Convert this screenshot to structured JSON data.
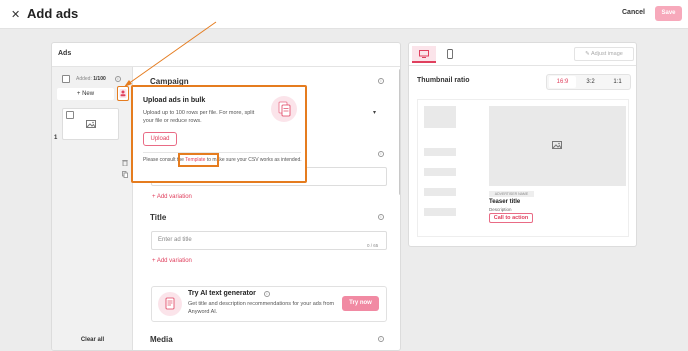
{
  "header": {
    "close_icon": "close-icon",
    "title": "Add ads",
    "cancel_label": "Cancel",
    "save_label": "Save"
  },
  "ads": {
    "heading": "Ads",
    "added_label": "Added:",
    "added_count": "1/100",
    "new_button": "+ New",
    "row_number": "1",
    "clear_all": "Clear all"
  },
  "form": {
    "campaign_label": "Campaign",
    "add_variation_label": "+ Add variation",
    "title_label": "Title",
    "title_placeholder": "Enter ad title",
    "title_counter": "0 / 65",
    "media_label": "Media"
  },
  "ai_generator": {
    "title": "Try AI text generator",
    "description": "Get title and description recommendations for your ads from Anyword AI.",
    "button": "Try now"
  },
  "bulk_upload_popup": {
    "title": "Upload ads in bulk",
    "description": "Upload up to 100 rows per file. For more, split your file or reduce rows.",
    "upload_button": "Upload",
    "note_prefix": "Please consult the",
    "template_link": "Template",
    "note_suffix": "to make sure your CSV works as intended."
  },
  "preview": {
    "adjust_image": "Adjust image",
    "thumbnail_ratio_label": "Thumbnail ratio",
    "ratios": [
      "16:9",
      "3:2",
      "1:1"
    ],
    "selected_ratio": "16:9",
    "advertiser_name": "ADVERTISER NAME",
    "teaser_title": "Teaser title",
    "description": "Description",
    "cta": "Call to action"
  },
  "colors": {
    "accent": "#e0405e",
    "annotation": "#e57c1f",
    "save_disabled": "#f7a9bb"
  }
}
